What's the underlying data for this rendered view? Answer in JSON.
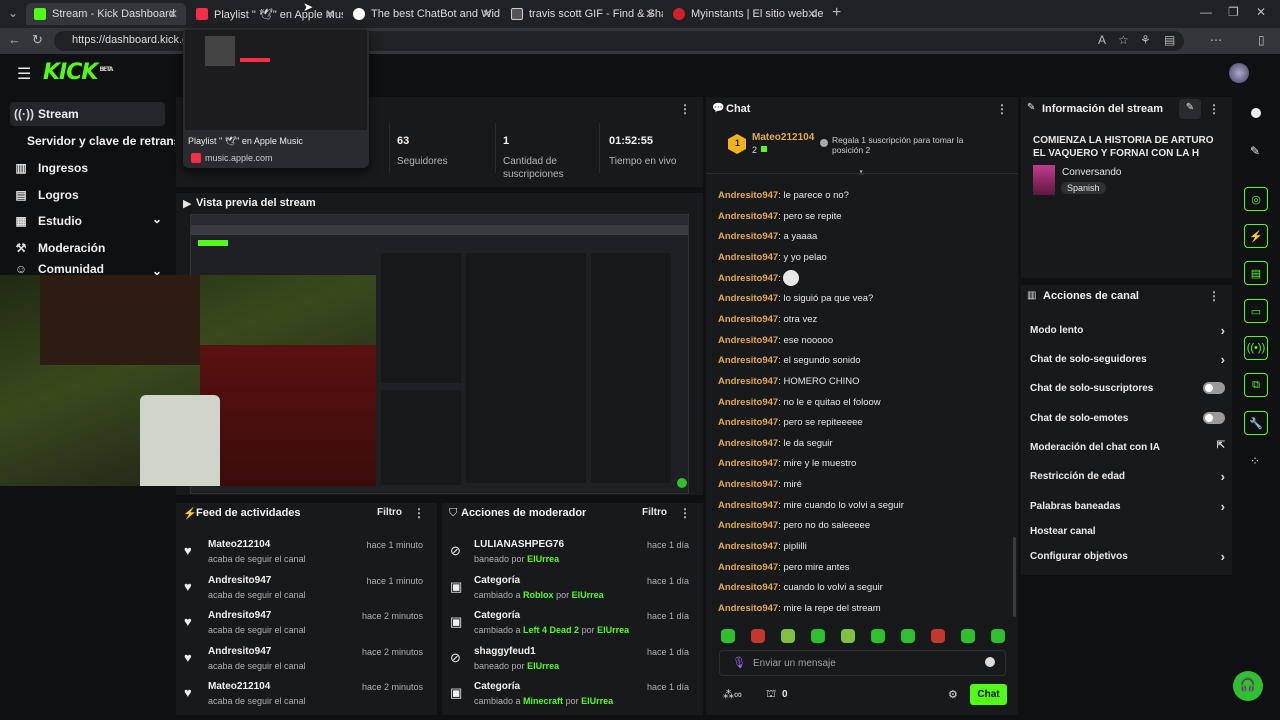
{
  "browser": {
    "tabs": [
      {
        "title": "Stream - Kick Dashboard",
        "color": "#53fc18"
      },
      {
        "title": "Playlist \" 🕊\" en Apple Music",
        "color": "#fa2d48"
      },
      {
        "title": "The best ChatBot and Widgets for",
        "color": "#ffffff"
      },
      {
        "title": "travis scott GIF - Find & Share on",
        "color": "#9a9a9a"
      },
      {
        "title": "Myinstants | El sitio web de boton",
        "color": "#d21f2b"
      }
    ],
    "url": "https://dashboard.kick.com",
    "tab_preview": {
      "title": "Playlist \" 🕊\" en Apple Music",
      "domain": "music.apple.com"
    }
  },
  "app": {
    "logo": "KICK",
    "logo_sup": "BETA"
  },
  "sidebar": {
    "items": [
      {
        "label": "Stream",
        "icon": "stream-icon"
      },
      {
        "label": "Servidor y clave de retransm",
        "icon": ""
      },
      {
        "label": "Ingresos",
        "icon": "income-icon"
      },
      {
        "label": "Logros",
        "icon": "achievements-icon"
      },
      {
        "label": "Estudio",
        "icon": "studio-icon"
      },
      {
        "label": "Moderación",
        "icon": "moderation-icon"
      },
      {
        "label": "Comunidad",
        "icon": "community-icon"
      }
    ]
  },
  "stats": [
    {
      "value": "63",
      "label": "Seguidores"
    },
    {
      "value": "1",
      "label": "Cantidad de suscripciones"
    },
    {
      "value": "01:52:55",
      "label": "Tiempo en vivo"
    }
  ],
  "preview": {
    "title": "Vista previa del stream"
  },
  "activity": {
    "title": "Feed de actividades",
    "filter": "Filtro",
    "items": [
      {
        "name": "Mateo212104",
        "sub": "acaba de seguir el canal",
        "time": "hace 1 minuto"
      },
      {
        "name": "Andresito947",
        "sub": "acaba de seguir el canal",
        "time": "hace 1 minuto"
      },
      {
        "name": "Andresito947",
        "sub": "acaba de seguir el canal",
        "time": "hace 2 minutos"
      },
      {
        "name": "Andresito947",
        "sub": "acaba de seguir el canal",
        "time": "hace 2 minutos"
      },
      {
        "name": "Mateo212104",
        "sub": "acaba de seguir el canal",
        "time": "hace 2 minutos"
      }
    ]
  },
  "modactions": {
    "title": "Acciones de moderador",
    "filter": "Filtro",
    "items": [
      {
        "name": "LULIANASHPEG76",
        "pre": "baneado por",
        "hl": "",
        "mid": "",
        "by": "ElUrrea",
        "time": "hace 1 día"
      },
      {
        "name": "Categoría",
        "pre": "cambiado a",
        "hl": "Roblox",
        "mid": "por",
        "by": "ElUrrea",
        "time": "hace 1 día"
      },
      {
        "name": "Categoría",
        "pre": "cambiado a",
        "hl": "Left 4 Dead 2",
        "mid": "por",
        "by": "ElUrrea",
        "time": "hace 1 día"
      },
      {
        "name": "shaggyfeud1",
        "pre": "baneado por",
        "hl": "",
        "mid": "",
        "by": "ElUrrea",
        "time": "hace 1 día"
      },
      {
        "name": "Categoría",
        "pre": "cambiado a",
        "hl": "Minecraft",
        "mid": "por",
        "by": "ElUrrea",
        "time": "hace 1 día"
      }
    ]
  },
  "chat": {
    "title": "Chat",
    "pinned_user": "Mateo212104",
    "pinned_count": "2",
    "pinned_rule": "Regala 1 suscripción para tomar la posición 2",
    "messages": [
      {
        "user": "Andresito947",
        "text": "le parece o no?"
      },
      {
        "user": "Andresito947",
        "text": "pero se repite"
      },
      {
        "user": "Andresito947",
        "text": "a yaaaa"
      },
      {
        "user": "Andresito947",
        "text": "y yo pelao"
      },
      {
        "user": "Andresito947",
        "text": ""
      },
      {
        "user": "Andresito947",
        "text": "lo siguió pa que vea?"
      },
      {
        "user": "Andresito947",
        "text": "otra vez"
      },
      {
        "user": "Andresito947",
        "text": "ese nooooo"
      },
      {
        "user": "Andresito947",
        "text": "el segundo sonido"
      },
      {
        "user": "Andresito947",
        "text": "HOMERO CHINO"
      },
      {
        "user": "Andresito947",
        "text": "no le e quitao el foloow"
      },
      {
        "user": "Andresito947",
        "text": "pero se repiteeeee"
      },
      {
        "user": "Andresito947",
        "text": "le da seguir"
      },
      {
        "user": "Andresito947",
        "text": "mire y le muestro"
      },
      {
        "user": "Andresito947",
        "text": "miré"
      },
      {
        "user": "Andresito947",
        "text": "mire cuando lo volvi a seguir"
      },
      {
        "user": "Andresito947",
        "text": "pero no do saleeeee"
      },
      {
        "user": "Andresito947",
        "text": "piplilli"
      },
      {
        "user": "Andresito947",
        "text": "pero mire antes"
      },
      {
        "user": "Andresito947",
        "text": "cuando lo volvi a seguir"
      },
      {
        "user": "Andresito947",
        "text": "mire la repe del stream"
      }
    ],
    "input_placeholder": "Enviar un mensaje",
    "points": "0",
    "send_label": "Chat"
  },
  "stream_info": {
    "title": "Información del stream",
    "stream_title": "COMIENZA LA HISTORIA DE ARTURO EL VAQUERO Y FORNAI CON LA H",
    "category": "Conversando",
    "language": "Spanish"
  },
  "channel_actions": {
    "title": "Acciones de canal",
    "items": [
      {
        "label": "Modo lento",
        "kind": "chevron"
      },
      {
        "label": "Chat de solo-seguidores",
        "kind": "chevron"
      },
      {
        "label": "Chat de solo-suscriptores",
        "kind": "toggle"
      },
      {
        "label": "Chat de solo-emotes",
        "kind": "toggle"
      },
      {
        "label": "Moderación del chat con IA",
        "kind": "external"
      },
      {
        "label": "Restricción de edad",
        "kind": "chevron"
      },
      {
        "label": "Palabras baneadas",
        "kind": "chevron"
      },
      {
        "label": "Hostear canal",
        "kind": "none"
      },
      {
        "label": "Configurar objetivos",
        "kind": "chevron"
      }
    ]
  },
  "colors": {
    "accent": "#53fc18",
    "panel": "#18191b",
    "username": "#e3a94d"
  }
}
